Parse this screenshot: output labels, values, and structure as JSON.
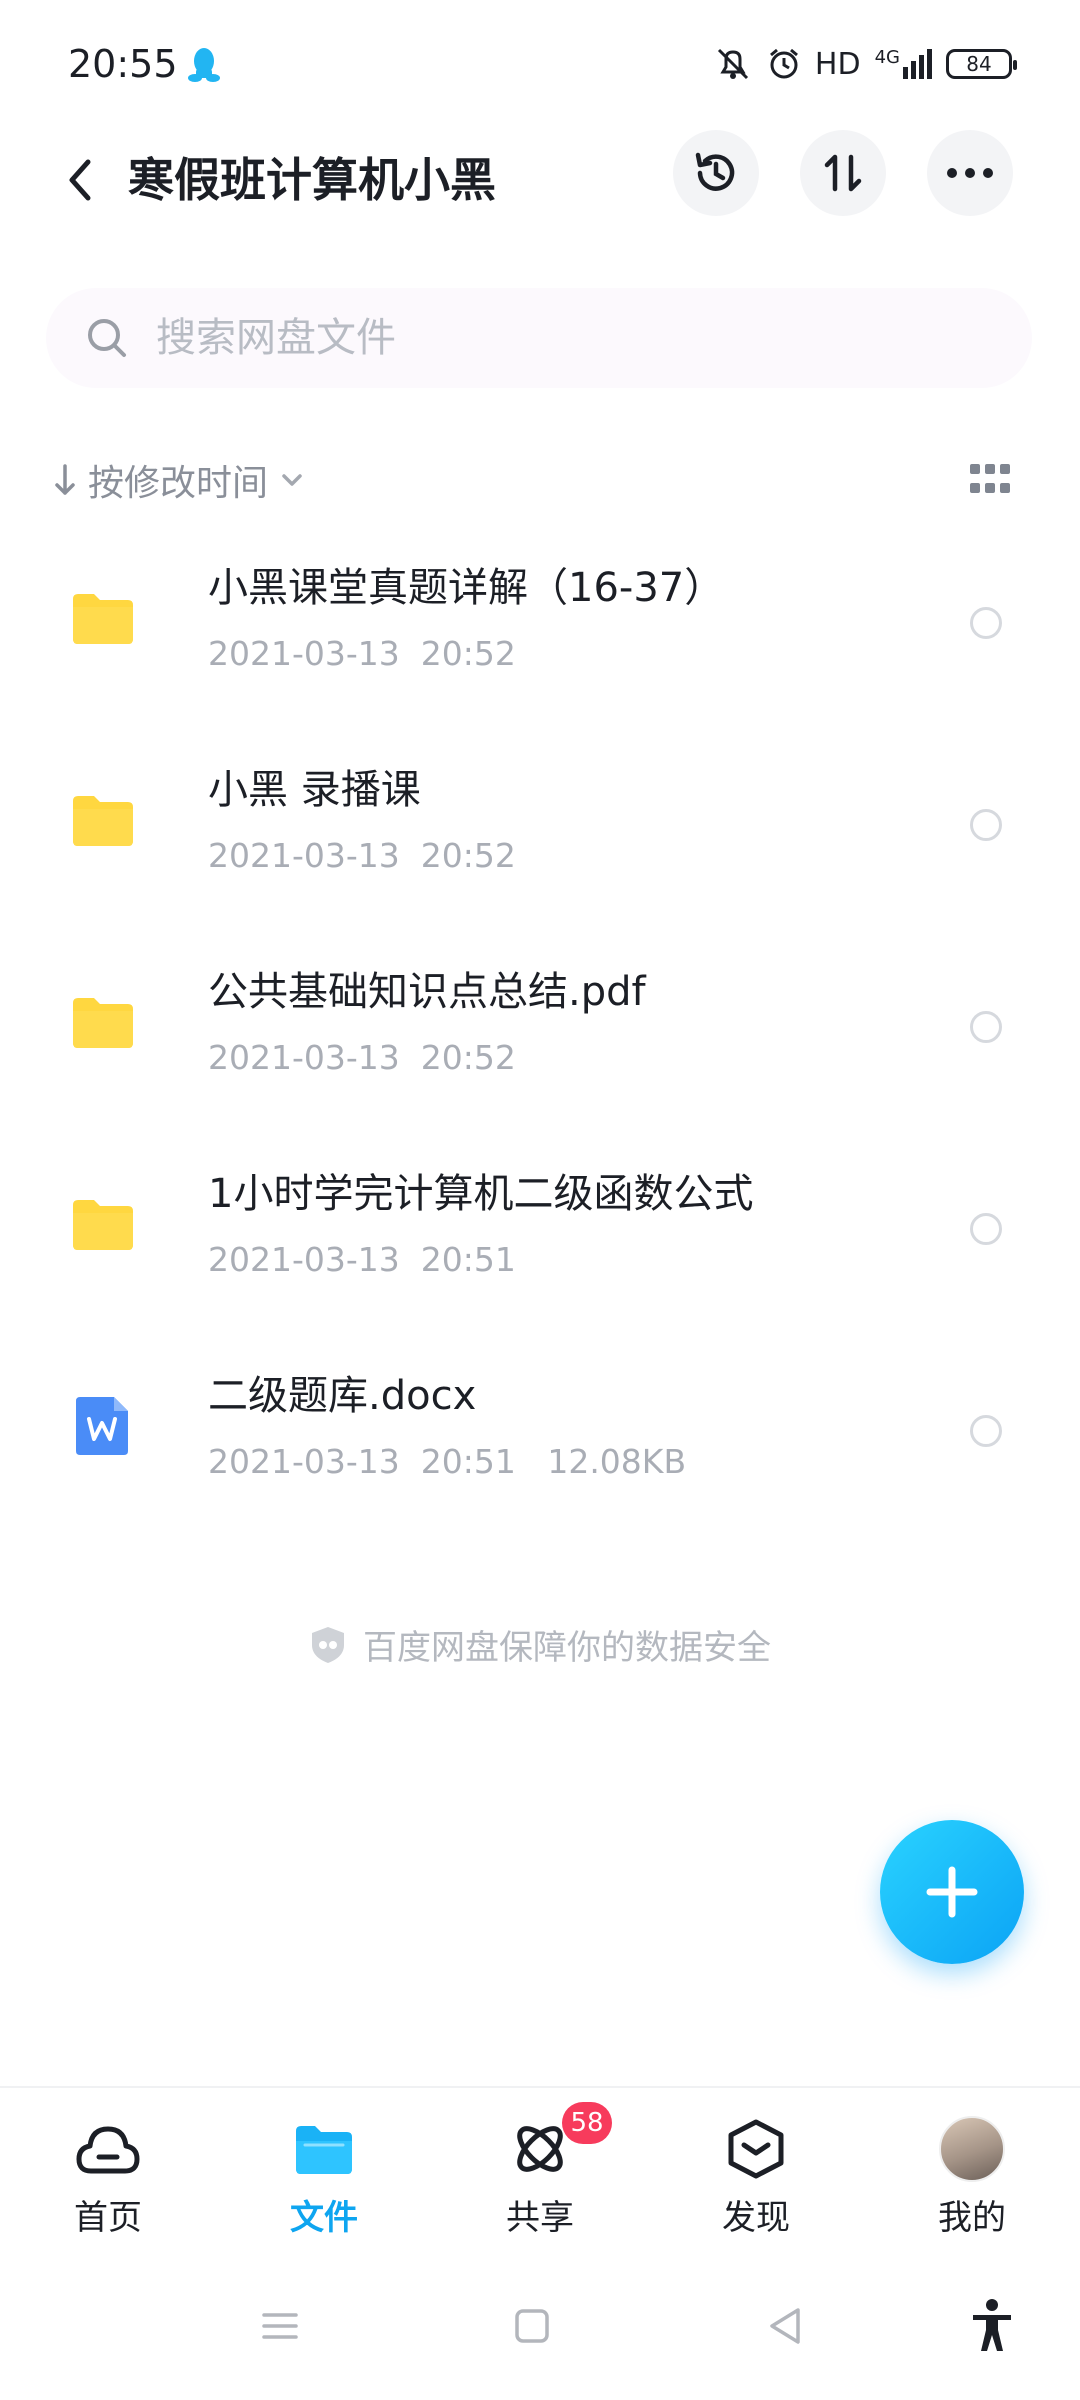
{
  "status_bar": {
    "time": "20:55",
    "hd": "HD",
    "network": "4G",
    "battery": "84"
  },
  "header": {
    "title": "寒假班计算机小黑"
  },
  "search": {
    "placeholder": "搜索网盘文件"
  },
  "sort": {
    "label": "按修改时间"
  },
  "files": [
    {
      "name": "小黑课堂真题详解（16-37）",
      "meta": "2021-03-13  20:52",
      "type": "folder"
    },
    {
      "name": "小黑 录播课",
      "meta": "2021-03-13  20:52",
      "type": "folder"
    },
    {
      "name": "公共基础知识点总结.pdf",
      "meta": "2021-03-13  20:52",
      "type": "folder"
    },
    {
      "name": "1小时学完计算机二级函数公式",
      "meta": "2021-03-13  20:51",
      "type": "folder"
    },
    {
      "name": "二级题库.docx",
      "meta": "2021-03-13  20:51   12.08KB",
      "type": "word-doc"
    }
  ],
  "safety_note": "百度网盘保障你的数据安全",
  "bottom_nav": {
    "items": [
      {
        "label": "首页",
        "icon": "cloud-home-icon"
      },
      {
        "label": "文件",
        "icon": "folder-icon"
      },
      {
        "label": "共享",
        "icon": "share-atom-icon",
        "badge": "58"
      },
      {
        "label": "发现",
        "icon": "discover-box-icon"
      },
      {
        "label": "我的",
        "icon": "avatar"
      }
    ],
    "active": "文件"
  },
  "colors": {
    "accent": "#0ea5f0",
    "badge": "#f73b5c",
    "folder": "#ffd740",
    "word": "#4a8cf7"
  }
}
